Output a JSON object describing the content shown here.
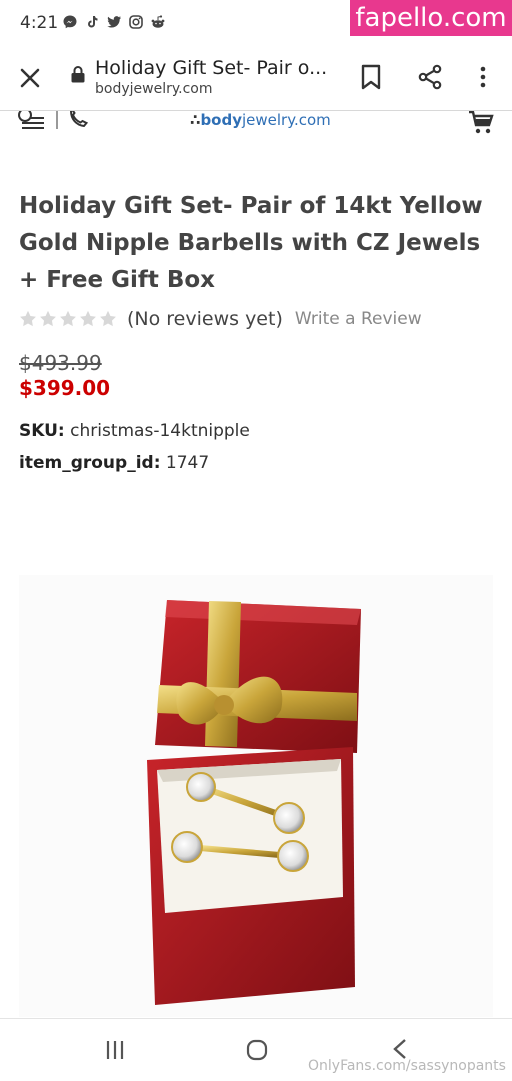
{
  "status_bar": {
    "time": "4:21",
    "icons": [
      "messenger-icon",
      "tiktok-icon",
      "twitter-icon",
      "instagram-icon",
      "reddit-icon"
    ]
  },
  "watermarks": {
    "top": "fapello.com",
    "bottom": "OnlyFans.com/sassynopants"
  },
  "browser": {
    "title": "Holiday Gift Set- Pair o...",
    "url": "bodyjewelry.com"
  },
  "site_header": {
    "logo_prefix": "body",
    "logo_suffix": "jewelry.com"
  },
  "product": {
    "title": "Holiday Gift Set- Pair of 14kt Yellow Gold Nipple Barbells with CZ Jewels + Free Gift Box",
    "star_count": 5,
    "rating": 0,
    "reviews_text": "(No reviews yet)",
    "write_review": "Write a Review",
    "price_old": "$493.99",
    "price_new": "$399.00",
    "sku_label": "SKU:",
    "sku_value": "christmas-14ktnipple",
    "group_label": "item_group_id:",
    "group_value": "1747"
  },
  "colors": {
    "price_accent": "#cc0000",
    "brand_blue": "#2f6fb5",
    "watermark_pink": "#e8388e"
  }
}
